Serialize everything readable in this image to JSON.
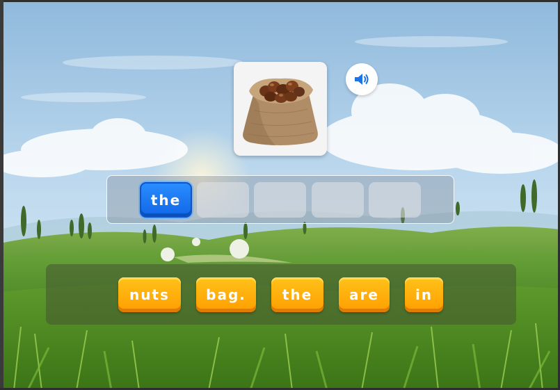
{
  "colors": {
    "sky": "#bcd8ee",
    "filled_slot": "#1a73f0",
    "word_chip": "#ffb000",
    "audio_icon": "#1a73e8"
  },
  "picture": {
    "icon": "sack-of-chestnuts"
  },
  "audio": {
    "icon": "speaker-icon"
  },
  "answer_slots": [
    {
      "text": "the",
      "filled": true
    },
    {
      "text": "",
      "filled": false
    },
    {
      "text": "",
      "filled": false
    },
    {
      "text": "",
      "filled": false
    },
    {
      "text": "",
      "filled": false
    }
  ],
  "word_bank": [
    {
      "text": "nuts"
    },
    {
      "text": "bag."
    },
    {
      "text": "the"
    },
    {
      "text": "are"
    },
    {
      "text": "in"
    }
  ]
}
